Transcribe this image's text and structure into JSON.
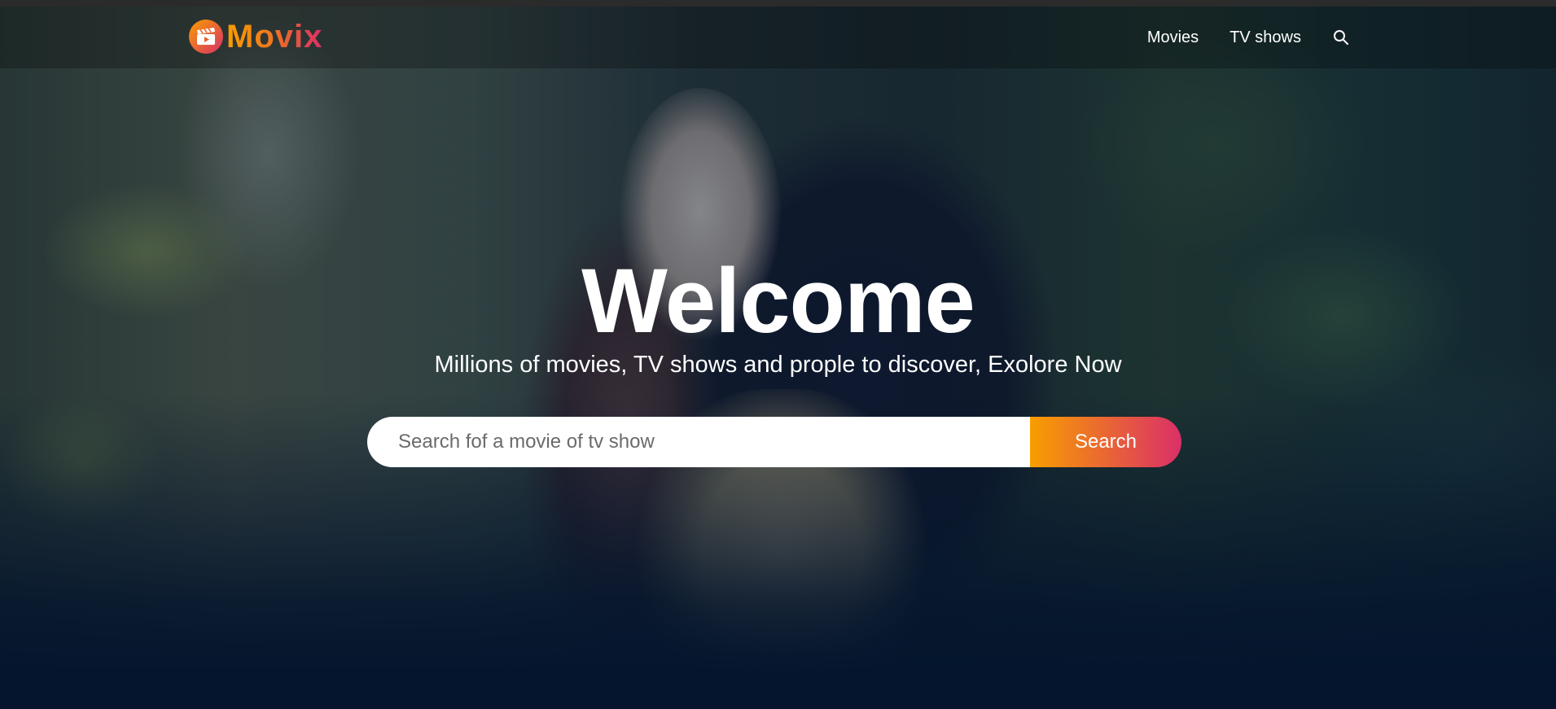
{
  "header": {
    "logo_text": "Movix",
    "nav": {
      "movies_label": "Movies",
      "tv_shows_label": "TV shows",
      "search_icon": "search-icon"
    }
  },
  "hero": {
    "title": "Welcome",
    "subtitle": "Millions of movies, TV shows and prople to discover, Exolore Now",
    "search": {
      "placeholder": "Search fof a movie of tv show",
      "value": "",
      "button_label": "Search"
    }
  },
  "colors": {
    "background": "#04152d",
    "accent_orange": "#f89e00",
    "accent_pink": "#da2f68",
    "text": "#ffffff"
  },
  "icons": {
    "logo": "film-clapper-icon"
  }
}
